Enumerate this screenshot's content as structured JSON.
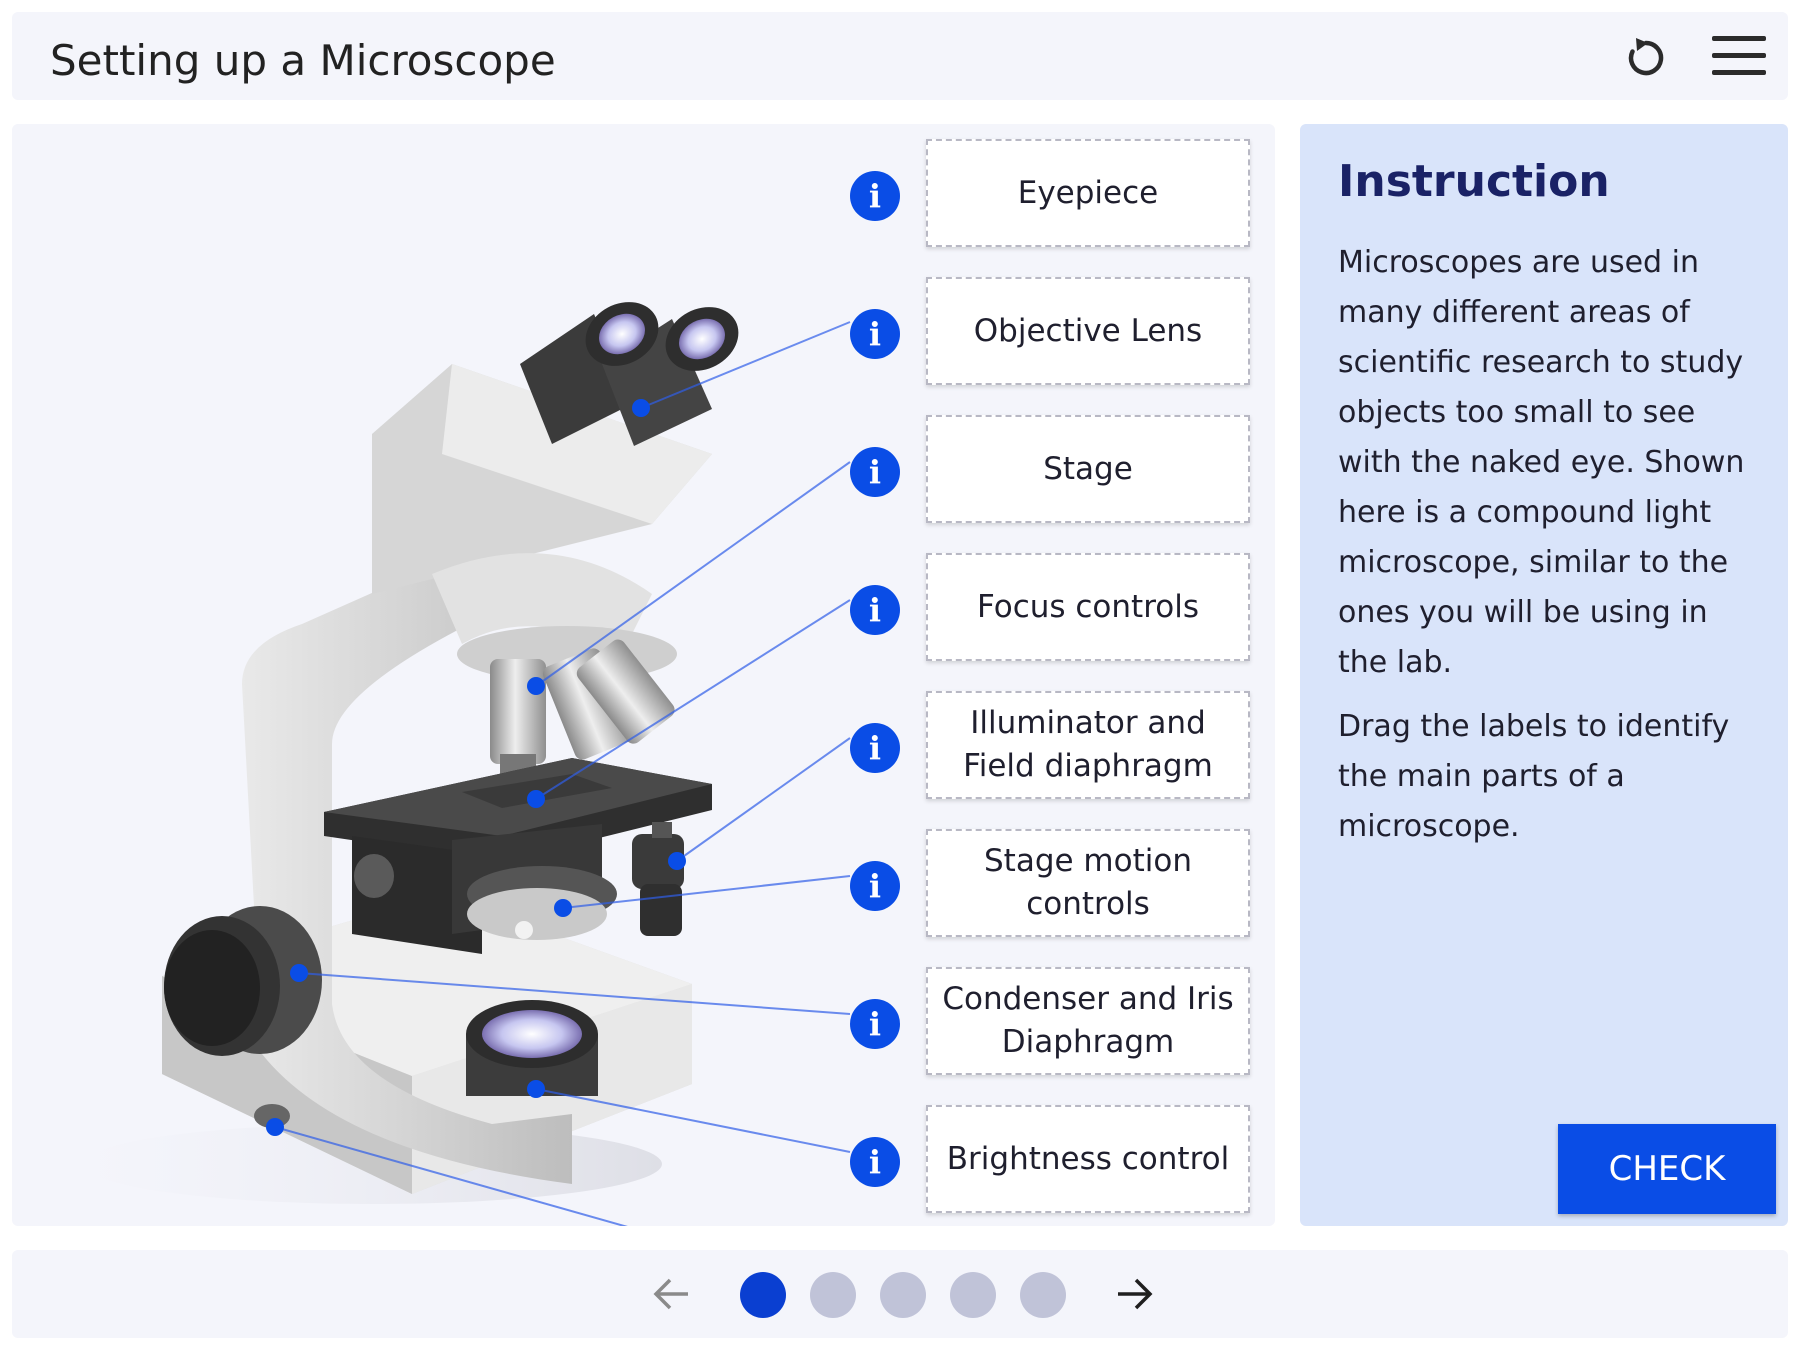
{
  "header": {
    "title": "Setting up a Microscope",
    "reload_icon": "reload-icon",
    "menu_icon": "hamburger-menu-icon"
  },
  "labels": [
    {
      "text": "Eyepiece"
    },
    {
      "text": "Objective Lens"
    },
    {
      "text": "Stage"
    },
    {
      "text": "Focus controls"
    },
    {
      "text": "Illuminator and Field diaphragm"
    },
    {
      "text": "Stage motion controls"
    },
    {
      "text": "Condenser and Iris Diaphragm"
    },
    {
      "text": "Brightness control"
    }
  ],
  "info_icon": "info-icon",
  "info_glyph": "i",
  "instruction": {
    "title": "Instruction",
    "paragraph1": "Microscopes are used in many different areas of scientific research to study objects too small to see with the naked eye. Shown here is a compound light microscope, similar to the ones you will be using in the lab.",
    "paragraph2": "Drag the labels to identify the main parts of a microscope.",
    "check_label": "CHECK"
  },
  "pagination": {
    "total": 5,
    "current": 1,
    "prev_icon": "arrow-left-icon",
    "next_icon": "arrow-right-icon"
  },
  "colors": {
    "accent": "#0a4de6",
    "panel": "#d9e4fa",
    "dot_active": "#0a3fd1",
    "dot_inactive": "#c0c3d8"
  }
}
